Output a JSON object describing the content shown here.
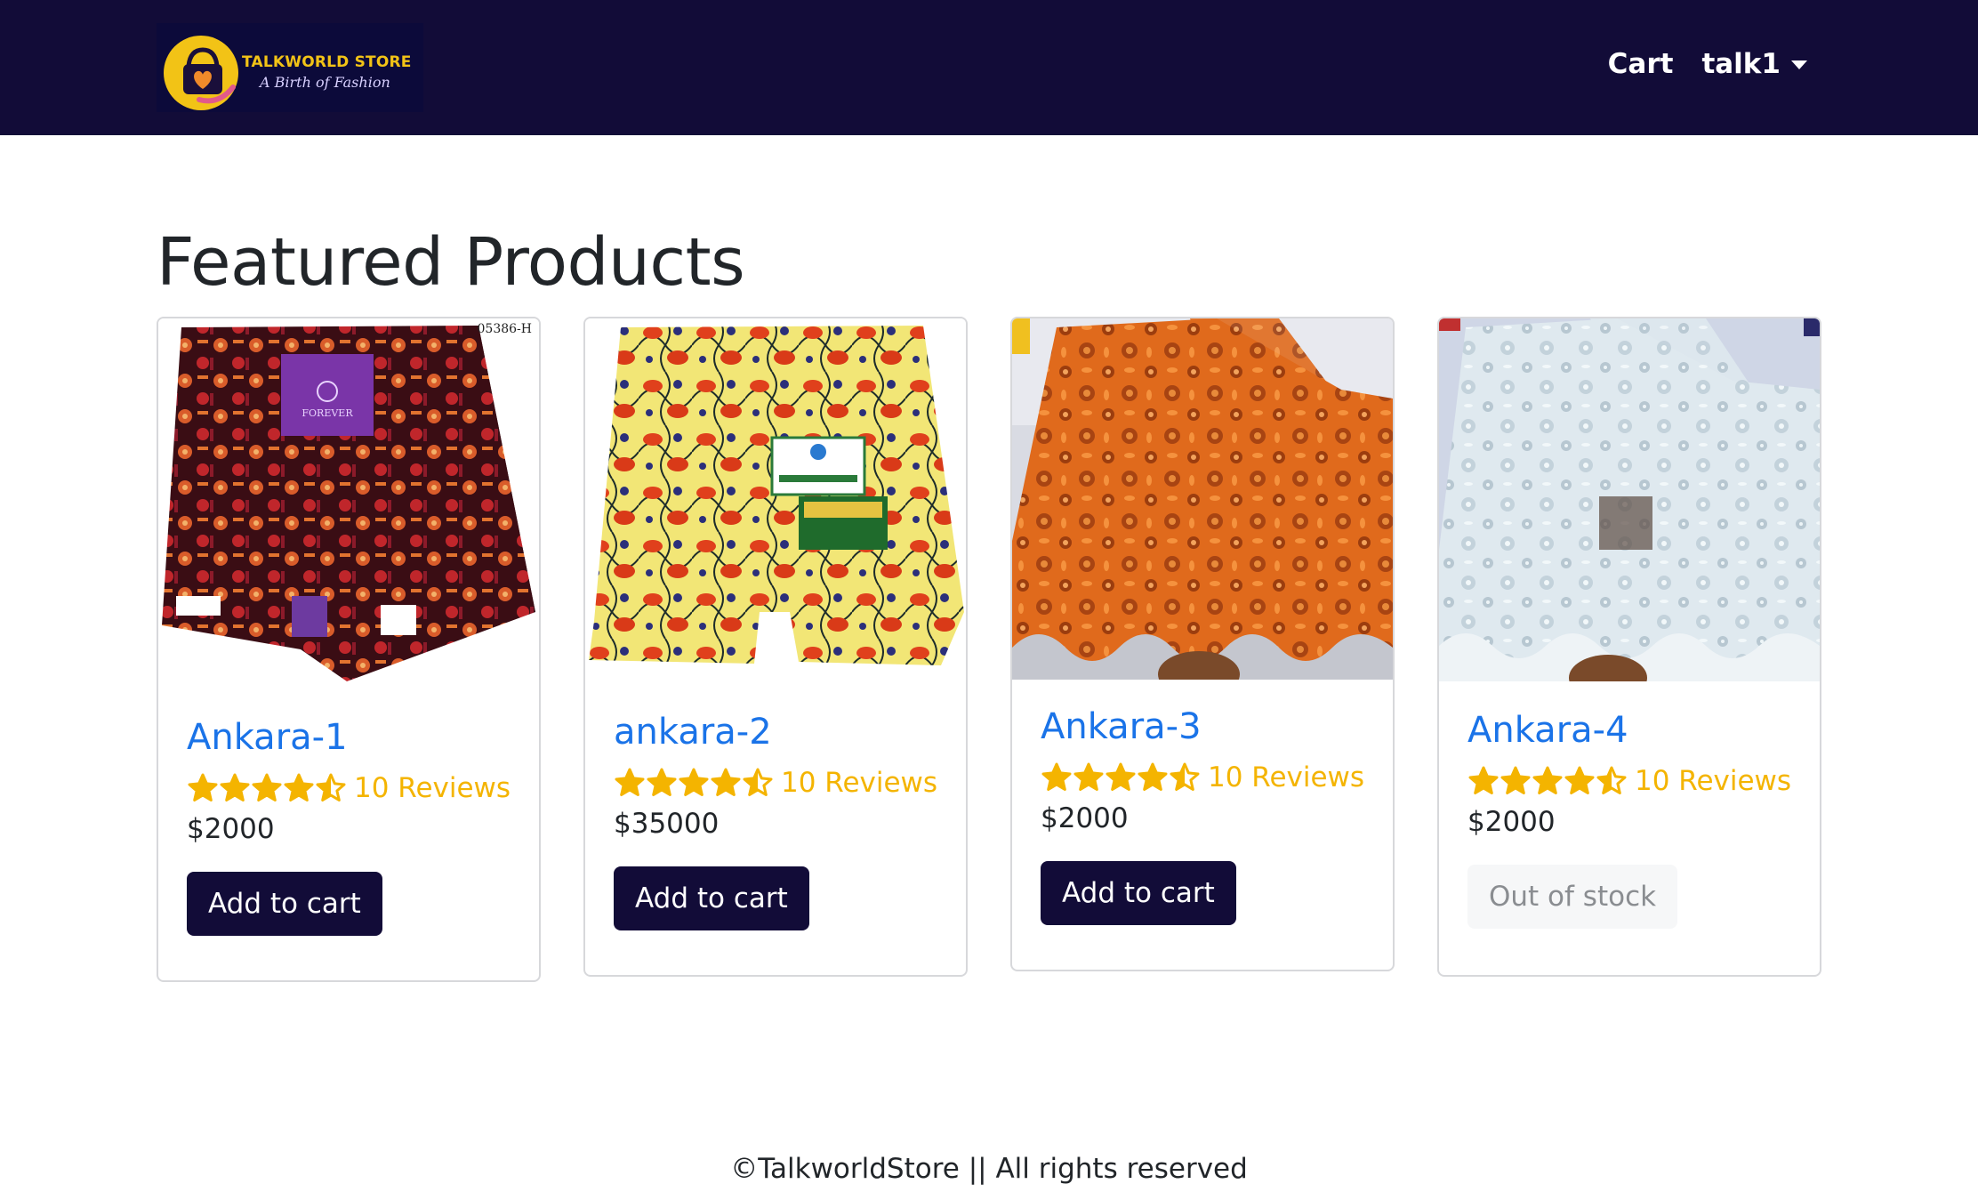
{
  "brand": {
    "logo_title": "TALKWORLD STORE",
    "logo_tagline": "A Birth of Fashion",
    "colors": {
      "navbar": "#120c38",
      "logo_gold": "#f2c316",
      "logo_pink": "#e25a8a"
    }
  },
  "nav": {
    "cart_label": "Cart",
    "user_label": "talk1",
    "user_icon": "caret-down-icon"
  },
  "page": {
    "title": "Featured Products"
  },
  "products": [
    {
      "name": "Ankara-1",
      "rating": 4.5,
      "reviews": "10 Reviews",
      "price": "$2000",
      "button": "Add to cart",
      "in_stock": true,
      "image_label": "05386-H",
      "tag_label": "FOREVER"
    },
    {
      "name": "ankara-2",
      "rating": 4.5,
      "reviews": "10 Reviews",
      "price": "$35000",
      "button": "Add to cart",
      "in_stock": true
    },
    {
      "name": "Ankara-3",
      "rating": 4.5,
      "reviews": "10 Reviews",
      "price": "$2000",
      "button": "Add to cart",
      "in_stock": true
    },
    {
      "name": "Ankara-4",
      "rating": 4.5,
      "reviews": "10 Reviews",
      "price": "$2000",
      "button": "Out of stock",
      "in_stock": false
    }
  ],
  "footer": {
    "text": "©TalkworldStore || All rights reserved"
  },
  "colors": {
    "link_blue": "#1a73e8",
    "star_gold": "#f4b400",
    "button_dark": "#120c38"
  }
}
